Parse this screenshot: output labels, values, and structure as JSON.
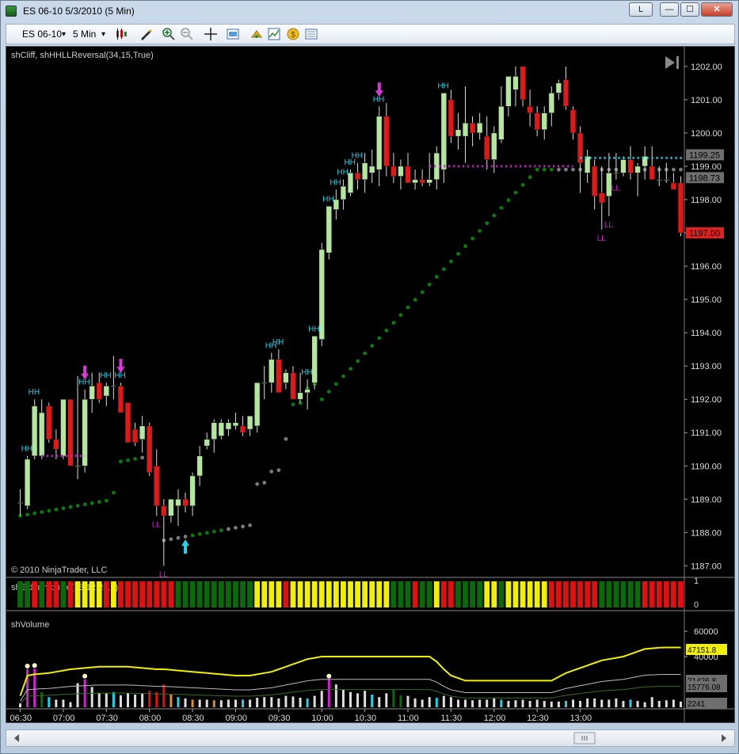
{
  "window": {
    "title": "ES 06-10  5/3/2010 (5 Min)",
    "link_button": "L",
    "minimize": "—",
    "maximize": "☐",
    "close": "✕"
  },
  "toolbar": {
    "instrument": "ES 06-10",
    "interval": "5 Min",
    "dropdown_glyph": "▾"
  },
  "price_panel": {
    "indicator_label": "shCliff, shHHLLReversal(34,15,True)",
    "copyright": "© 2010 NinjaTrader, LLC",
    "price_ticks": [
      "1202.00",
      "1201.00",
      "1200.00",
      "1199.00",
      "1198.00",
      "1197.00",
      "1196.00",
      "1195.00",
      "1194.00",
      "1193.00",
      "1192.00",
      "1191.00",
      "1190.00",
      "1189.00",
      "1188.00",
      "1187.00"
    ],
    "price_markers": [
      {
        "label": "1199.25",
        "color": "#6e6e6e"
      },
      {
        "label": "1198.73",
        "color": "#6e6e6e"
      },
      {
        "label": "1197.00",
        "color": "#e02020"
      }
    ]
  },
  "impulse_panel": {
    "label": "shElderImpulse(13,12,26,9)",
    "ticks": [
      "1",
      "0"
    ]
  },
  "volume_panel": {
    "label": "shVolume",
    "ticks": [
      "60000",
      "40000"
    ],
    "markers": [
      {
        "label": "47151.8",
        "color": "#e6e600"
      },
      {
        "label": "21426.8",
        "color": "#6e6e6e"
      },
      {
        "label": "15776.08",
        "color": "#6e6e6e"
      },
      {
        "label": "2241",
        "color": "#6e6e6e"
      }
    ]
  },
  "time_axis": [
    "06:30",
    "07:00",
    "07:30",
    "08:00",
    "08:30",
    "09:00",
    "09:30",
    "10:00",
    "10:30",
    "11:00",
    "11:30",
    "12:00",
    "12:30",
    "13:00"
  ],
  "hh_label": "HH",
  "ll_label": "LL",
  "colors": {
    "up_candle": "#b4e6a0",
    "down_candle": "#e01818",
    "hh": "#22d3e6",
    "ll": "#cc22cc",
    "arrow_down": "#d83ad8",
    "arrow_up": "#22d3e6",
    "cliff_green": "#0a7a0a",
    "cliff_gray": "#7a7a7a",
    "impulse_green": "#0a6a0a",
    "impulse_yellow": "#f0f000",
    "impulse_red": "#e01010",
    "vol_avg": "#f0f000"
  },
  "chart_data": {
    "type": "candlestick",
    "title": "ES 06-10  5/3/2010 (5 Min)",
    "ylim": [
      1186.7,
      1202.4
    ],
    "candles": [
      {
        "o": 1188.9,
        "h": 1189.3,
        "l": 1188.5,
        "c": 1188.9
      },
      {
        "o": 1188.8,
        "h": 1190.3,
        "l": 1188.7,
        "c": 1190.2
      },
      {
        "o": 1190.3,
        "h": 1192.0,
        "l": 1190.2,
        "c": 1191.8
      },
      {
        "o": 1190.3,
        "h": 1192.0,
        "l": 1190.2,
        "c": 1191.6
      },
      {
        "o": 1191.8,
        "h": 1191.9,
        "l": 1190.7,
        "c": 1190.8
      },
      {
        "o": 1190.8,
        "h": 1191.1,
        "l": 1190.2,
        "c": 1190.5
      },
      {
        "o": 1190.3,
        "h": 1192.0,
        "l": 1190.2,
        "c": 1192.0
      },
      {
        "o": 1192.0,
        "h": 1192.0,
        "l": 1190.0,
        "c": 1190.0
      },
      {
        "o": 1190.0,
        "h": 1192.7,
        "l": 1189.6,
        "c": 1190.0
      },
      {
        "o": 1190.0,
        "h": 1192.3,
        "l": 1189.8,
        "c": 1192.0
      },
      {
        "o": 1192.0,
        "h": 1192.8,
        "l": 1191.6,
        "c": 1192.4
      },
      {
        "o": 1192.5,
        "h": 1192.8,
        "l": 1191.9,
        "c": 1192.0
      },
      {
        "o": 1192.1,
        "h": 1192.5,
        "l": 1191.8,
        "c": 1192.4
      },
      {
        "o": 1192.4,
        "h": 1193.3,
        "l": 1192.0,
        "c": 1192.4
      },
      {
        "o": 1192.4,
        "h": 1192.5,
        "l": 1191.6,
        "c": 1191.6
      },
      {
        "o": 1191.9,
        "h": 1191.9,
        "l": 1190.7,
        "c": 1190.7
      },
      {
        "o": 1191.1,
        "h": 1191.3,
        "l": 1190.6,
        "c": 1190.7
      },
      {
        "o": 1190.8,
        "h": 1191.5,
        "l": 1190.4,
        "c": 1191.2
      },
      {
        "o": 1191.2,
        "h": 1191.3,
        "l": 1189.7,
        "c": 1189.8
      },
      {
        "o": 1190.0,
        "h": 1190.5,
        "l": 1188.5,
        "c": 1188.8
      },
      {
        "o": 1188.8,
        "h": 1189.0,
        "l": 1187.0,
        "c": 1188.5
      },
      {
        "o": 1188.5,
        "h": 1189.0,
        "l": 1188.3,
        "c": 1189.0
      },
      {
        "o": 1188.8,
        "h": 1189.3,
        "l": 1188.2,
        "c": 1189.0
      },
      {
        "o": 1189.0,
        "h": 1189.2,
        "l": 1188.6,
        "c": 1188.8
      },
      {
        "o": 1188.8,
        "h": 1189.8,
        "l": 1188.5,
        "c": 1189.7
      },
      {
        "o": 1189.7,
        "h": 1190.6,
        "l": 1189.4,
        "c": 1190.3
      },
      {
        "o": 1190.6,
        "h": 1191.0,
        "l": 1190.5,
        "c": 1190.8
      },
      {
        "o": 1190.8,
        "h": 1191.4,
        "l": 1190.4,
        "c": 1191.3
      },
      {
        "o": 1190.9,
        "h": 1191.4,
        "l": 1190.8,
        "c": 1191.3
      },
      {
        "o": 1191.1,
        "h": 1191.4,
        "l": 1190.9,
        "c": 1191.3
      },
      {
        "o": 1191.2,
        "h": 1191.6,
        "l": 1191.1,
        "c": 1191.3
      },
      {
        "o": 1191.2,
        "h": 1191.5,
        "l": 1190.9,
        "c": 1191.0
      },
      {
        "o": 1191.1,
        "h": 1191.5,
        "l": 1190.9,
        "c": 1191.5
      },
      {
        "o": 1191.2,
        "h": 1192.5,
        "l": 1191.0,
        "c": 1192.5
      },
      {
        "o": 1192.5,
        "h": 1193.0,
        "l": 1192.0,
        "c": 1192.5
      },
      {
        "o": 1192.5,
        "h": 1193.4,
        "l": 1192.2,
        "c": 1193.2
      },
      {
        "o": 1193.2,
        "h": 1193.5,
        "l": 1192.2,
        "c": 1192.2
      },
      {
        "o": 1192.5,
        "h": 1192.9,
        "l": 1192.3,
        "c": 1192.8
      },
      {
        "o": 1192.8,
        "h": 1193.0,
        "l": 1192.0,
        "c": 1192.0
      },
      {
        "o": 1192.0,
        "h": 1192.8,
        "l": 1191.9,
        "c": 1192.2
      },
      {
        "o": 1192.2,
        "h": 1192.6,
        "l": 1191.7,
        "c": 1192.3
      },
      {
        "o": 1192.5,
        "h": 1193.9,
        "l": 1192.3,
        "c": 1193.9
      },
      {
        "o": 1193.8,
        "h": 1196.7,
        "l": 1193.6,
        "c": 1196.5
      },
      {
        "o": 1196.4,
        "h": 1197.8,
        "l": 1196.2,
        "c": 1197.8
      },
      {
        "o": 1197.7,
        "h": 1198.3,
        "l": 1197.4,
        "c": 1198.0
      },
      {
        "o": 1198.0,
        "h": 1198.6,
        "l": 1197.7,
        "c": 1198.4
      },
      {
        "o": 1198.2,
        "h": 1198.9,
        "l": 1198.1,
        "c": 1198.8
      },
      {
        "o": 1198.8,
        "h": 1199.1,
        "l": 1198.3,
        "c": 1198.6
      },
      {
        "o": 1198.6,
        "h": 1199.4,
        "l": 1198.2,
        "c": 1199.1
      },
      {
        "o": 1198.8,
        "h": 1199.5,
        "l": 1198.5,
        "c": 1199.0
      },
      {
        "o": 1198.9,
        "h": 1200.8,
        "l": 1198.4,
        "c": 1200.5
      },
      {
        "o": 1200.5,
        "h": 1200.9,
        "l": 1198.7,
        "c": 1199.0
      },
      {
        "o": 1199.0,
        "h": 1199.4,
        "l": 1198.5,
        "c": 1198.7
      },
      {
        "o": 1198.7,
        "h": 1199.2,
        "l": 1198.3,
        "c": 1199.0
      },
      {
        "o": 1199.0,
        "h": 1199.4,
        "l": 1198.6,
        "c": 1198.5
      },
      {
        "o": 1198.5,
        "h": 1198.9,
        "l": 1198.3,
        "c": 1198.6
      },
      {
        "o": 1198.6,
        "h": 1198.9,
        "l": 1198.4,
        "c": 1198.5
      },
      {
        "o": 1198.5,
        "h": 1199.4,
        "l": 1198.4,
        "c": 1198.6
      },
      {
        "o": 1198.6,
        "h": 1199.6,
        "l": 1198.3,
        "c": 1199.4
      },
      {
        "o": 1198.9,
        "h": 1201.2,
        "l": 1198.5,
        "c": 1201.2
      },
      {
        "o": 1201.0,
        "h": 1201.3,
        "l": 1199.7,
        "c": 1199.9
      },
      {
        "o": 1199.9,
        "h": 1200.6,
        "l": 1199.5,
        "c": 1200.1
      },
      {
        "o": 1199.9,
        "h": 1201.4,
        "l": 1199.1,
        "c": 1200.3
      },
      {
        "o": 1200.3,
        "h": 1200.5,
        "l": 1199.6,
        "c": 1200.0
      },
      {
        "o": 1200.0,
        "h": 1200.6,
        "l": 1199.8,
        "c": 1200.3
      },
      {
        "o": 1199.9,
        "h": 1200.5,
        "l": 1198.9,
        "c": 1199.2
      },
      {
        "o": 1199.2,
        "h": 1200.2,
        "l": 1198.8,
        "c": 1200.0
      },
      {
        "o": 1199.8,
        "h": 1201.4,
        "l": 1199.7,
        "c": 1200.8
      },
      {
        "o": 1200.8,
        "h": 1201.5,
        "l": 1200.5,
        "c": 1201.7
      },
      {
        "o": 1201.3,
        "h": 1202.0,
        "l": 1200.8,
        "c": 1201.7
      },
      {
        "o": 1202.0,
        "h": 1202.0,
        "l": 1200.8,
        "c": 1201.0
      },
      {
        "o": 1200.8,
        "h": 1201.3,
        "l": 1200.2,
        "c": 1200.6
      },
      {
        "o": 1200.6,
        "h": 1200.8,
        "l": 1199.9,
        "c": 1200.1
      },
      {
        "o": 1200.1,
        "h": 1200.8,
        "l": 1199.8,
        "c": 1200.6
      },
      {
        "o": 1200.6,
        "h": 1201.4,
        "l": 1200.2,
        "c": 1201.2
      },
      {
        "o": 1201.2,
        "h": 1201.6,
        "l": 1201.0,
        "c": 1201.5
      },
      {
        "o": 1201.6,
        "h": 1202.0,
        "l": 1200.7,
        "c": 1200.8
      },
      {
        "o": 1200.7,
        "h": 1200.8,
        "l": 1199.8,
        "c": 1200.0
      },
      {
        "o": 1200.0,
        "h": 1200.2,
        "l": 1198.2,
        "c": 1199.1
      },
      {
        "o": 1198.8,
        "h": 1199.5,
        "l": 1198.5,
        "c": 1199.3
      },
      {
        "o": 1199.0,
        "h": 1199.2,
        "l": 1197.7,
        "c": 1198.1
      },
      {
        "o": 1198.2,
        "h": 1199.0,
        "l": 1197.1,
        "c": 1197.9
      },
      {
        "o": 1198.1,
        "h": 1199.4,
        "l": 1197.5,
        "c": 1198.8
      },
      {
        "o": 1198.8,
        "h": 1199.4,
        "l": 1198.6,
        "c": 1198.8
      },
      {
        "o": 1198.8,
        "h": 1199.3,
        "l": 1198.7,
        "c": 1199.2
      },
      {
        "o": 1199.2,
        "h": 1199.6,
        "l": 1198.6,
        "c": 1198.8
      },
      {
        "o": 1198.8,
        "h": 1199.1,
        "l": 1198.1,
        "c": 1199.0
      },
      {
        "o": 1199.0,
        "h": 1199.6,
        "l": 1198.6,
        "c": 1199.3
      },
      {
        "o": 1199.0,
        "h": 1199.6,
        "l": 1198.9,
        "c": 1198.6
      },
      {
        "o": 1198.6,
        "h": 1199.0,
        "l": 1198.4,
        "c": 1198.6
      },
      {
        "o": 1198.6,
        "h": 1199.1,
        "l": 1198.5,
        "c": 1198.6
      },
      {
        "o": 1198.5,
        "h": 1198.8,
        "l": 1198.3,
        "c": 1198.3
      },
      {
        "o": 1198.5,
        "h": 1198.7,
        "l": 1196.9,
        "c": 1197.0
      }
    ],
    "impulse": [
      "green",
      "green",
      "red",
      "green",
      "red",
      "red",
      "green",
      "red",
      "yellow",
      "yellow",
      "yellow",
      "yellow",
      "red",
      "yellow",
      "red",
      "red",
      "red",
      "red",
      "red",
      "red",
      "red",
      "red",
      "green",
      "green",
      "green",
      "green",
      "green",
      "green",
      "green",
      "green",
      "green",
      "green",
      "green",
      "yellow",
      "yellow",
      "yellow",
      "yellow",
      "red",
      "yellow",
      "yellow",
      "yellow",
      "yellow",
      "yellow",
      "yellow",
      "yellow",
      "yellow",
      "yellow",
      "yellow",
      "yellow",
      "yellow",
      "yellow",
      "yellow",
      "green",
      "green",
      "green",
      "red",
      "green",
      "green",
      "yellow",
      "red",
      "red",
      "green",
      "green",
      "green",
      "green",
      "yellow",
      "yellow",
      "green",
      "yellow",
      "yellow",
      "yellow",
      "yellow",
      "yellow",
      "yellow",
      "red",
      "red",
      "red",
      "red",
      "red",
      "red",
      "red",
      "green",
      "green",
      "green",
      "green",
      "green",
      "green",
      "red",
      "red",
      "red",
      "red",
      "red",
      "red"
    ],
    "volume": [
      3000,
      30000,
      30500,
      12000,
      8000,
      6000,
      6000,
      4000,
      19000,
      22000,
      16000,
      11000,
      11000,
      12000,
      9500,
      11000,
      10000,
      11000,
      13000,
      12000,
      18000,
      10000,
      8000,
      7000,
      6000,
      6000,
      6000,
      5500,
      5500,
      6000,
      6000,
      6000,
      6000,
      7500,
      8000,
      8000,
      7000,
      9000,
      8500,
      7500,
      7000,
      9000,
      13000,
      22000,
      18000,
      14000,
      12000,
      11000,
      13000,
      10000,
      8000,
      11000,
      14000,
      9500,
      9000,
      7000,
      6000,
      8000,
      7500,
      9000,
      8000,
      6000,
      6000,
      5500,
      6000,
      6000,
      7000,
      6000,
      5000,
      5500,
      6000,
      5000,
      6000,
      5000,
      4500,
      4500,
      5000,
      6000,
      5000,
      7000,
      7000,
      6000,
      6000,
      7000,
      5000,
      6000,
      5000,
      4000,
      8000,
      5000,
      5500,
      6000,
      4500
    ],
    "volume_avg": [
      9000,
      25000,
      26000,
      26500,
      27000,
      28000,
      29000,
      30000,
      30500,
      31000,
      31500,
      32000,
      32000,
      32000,
      32000,
      32000,
      31500,
      31000,
      30500,
      30000,
      30000,
      29500,
      29000,
      28500,
      28000,
      27500,
      27000,
      26500,
      26000,
      25500,
      25000,
      25000,
      25000,
      26000,
      27000,
      28000,
      30000,
      32000,
      34000,
      36000,
      38000,
      39000,
      40000,
      40000,
      40000,
      40000,
      40000,
      40000,
      40000,
      40000,
      40000,
      40000,
      40000,
      40000,
      40000,
      40000,
      40000,
      40000,
      36000,
      30000,
      25000,
      23000,
      21000,
      21000,
      21000,
      21000,
      21000,
      21000,
      21000,
      21000,
      21000,
      21000,
      21000,
      21000,
      21000,
      24000,
      27000,
      29000,
      31000,
      33000,
      35000,
      37000,
      38000,
      39000,
      40000,
      42000,
      44000,
      46000,
      46500,
      47000,
      47150,
      47151,
      47151.8
    ]
  }
}
